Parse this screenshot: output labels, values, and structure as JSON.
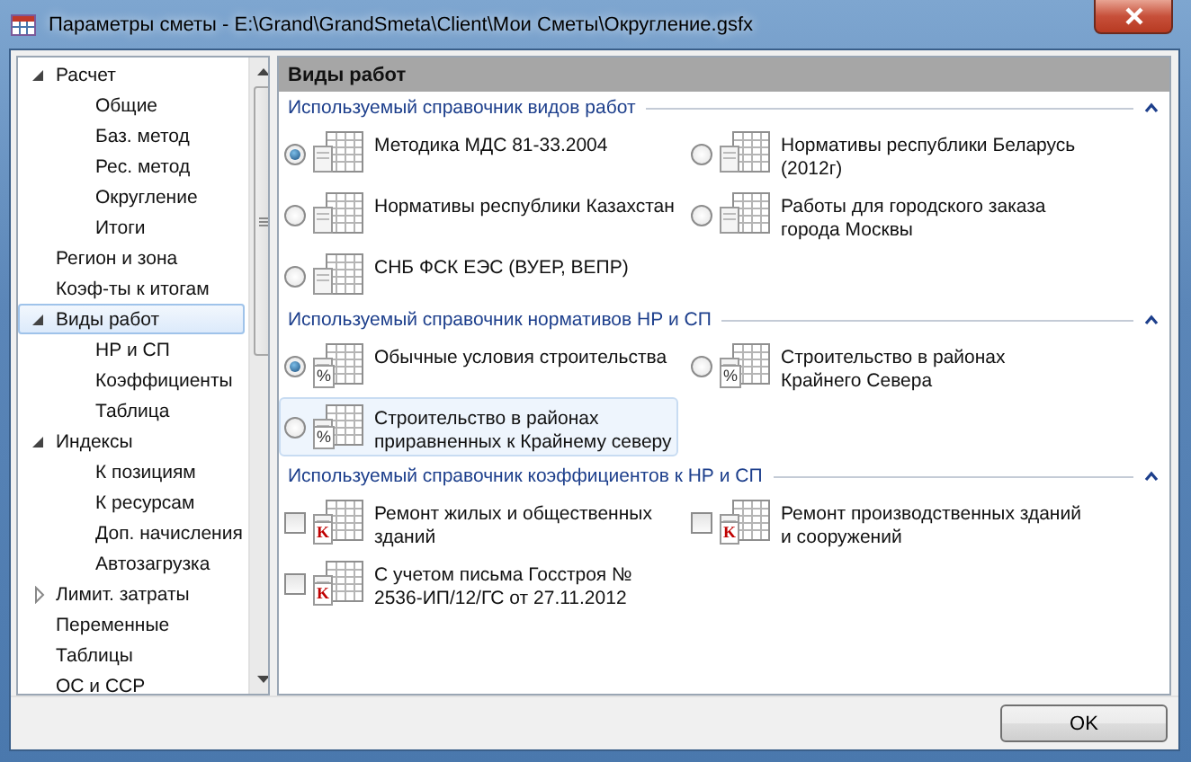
{
  "window": {
    "title": "Параметры сметы - E:\\Grand\\GrandSmeta\\Client\\Мои Сметы\\Округление.gsfx"
  },
  "sidebar": {
    "items": [
      {
        "label": "Расчет",
        "expanded": true,
        "selected": false,
        "children": [
          {
            "label": "Общие",
            "selected": false
          },
          {
            "label": "Баз. метод",
            "selected": false
          },
          {
            "label": "Рес. метод",
            "selected": false
          },
          {
            "label": "Округление",
            "selected": false
          },
          {
            "label": "Итоги",
            "selected": false
          }
        ]
      },
      {
        "label": "Регион и зона",
        "selected": false
      },
      {
        "label": "Коэф-ты к итогам",
        "selected": false
      },
      {
        "label": "Виды работ",
        "expanded": true,
        "selected": true,
        "children": [
          {
            "label": "НР и СП",
            "selected": false
          },
          {
            "label": "Коэффициенты",
            "selected": false
          },
          {
            "label": "Таблица",
            "selected": false
          }
        ]
      },
      {
        "label": "Индексы",
        "expanded": true,
        "selected": false,
        "children": [
          {
            "label": "К позициям",
            "selected": false
          },
          {
            "label": "К ресурсам",
            "selected": false
          },
          {
            "label": "Доп. начисления",
            "selected": false
          },
          {
            "label": "Автозагрузка",
            "selected": false
          }
        ]
      },
      {
        "label": "Лимит. затраты",
        "expanded": false,
        "selected": false
      },
      {
        "label": "Переменные",
        "selected": false
      },
      {
        "label": "Таблицы",
        "selected": false
      },
      {
        "label": "ОС и ССР",
        "selected": false
      }
    ]
  },
  "panel": {
    "title": "Виды работ",
    "sections": [
      {
        "title": "Используемый справочник видов работ",
        "expanded": true,
        "items": [
          {
            "kind": "radio",
            "label": "Методика МДС 81-33.2004",
            "selected": true,
            "hovered": false
          },
          {
            "kind": "radio",
            "label": "Нормативы республики Беларусь (2012г)",
            "selected": false,
            "hovered": false
          },
          {
            "kind": "radio",
            "label": "Нормативы республики Казахстан",
            "selected": false,
            "hovered": false
          },
          {
            "kind": "radio",
            "label": "Работы для городского заказа города Москвы",
            "selected": false,
            "hovered": false
          },
          {
            "kind": "radio",
            "label": "СНБ ФСК ЕЭС (ВУЕР, ВЕПР)",
            "selected": false,
            "hovered": false
          }
        ]
      },
      {
        "title": "Используемый справочник нормативов НР и СП",
        "expanded": true,
        "items": [
          {
            "kind": "radio",
            "badge": "%",
            "label": "Обычные условия строительства",
            "selected": true,
            "hovered": false
          },
          {
            "kind": "radio",
            "badge": "%",
            "label": "Строительство в районах Крайнего Севера",
            "selected": false,
            "hovered": false
          },
          {
            "kind": "radio",
            "badge": "%",
            "label": "Строительство в районах приравненных к Крайнему северу",
            "selected": false,
            "hovered": true
          }
        ]
      },
      {
        "title": "Используемый справочник коэффициентов к НР и СП",
        "expanded": true,
        "items": [
          {
            "kind": "checkbox",
            "badge": "K",
            "label": "Ремонт жилых и общественных зданий",
            "checked": false,
            "hovered": false
          },
          {
            "kind": "checkbox",
            "badge": "K",
            "label": "Ремонт производственных зданий и сооружений",
            "checked": false,
            "hovered": false
          },
          {
            "kind": "checkbox",
            "badge": "K",
            "label": "С учетом письма Госстроя № 2536-ИП/12/ГС от 27.11.2012",
            "checked": false,
            "hovered": false
          }
        ]
      }
    ]
  },
  "buttons": [
    "OK"
  ]
}
